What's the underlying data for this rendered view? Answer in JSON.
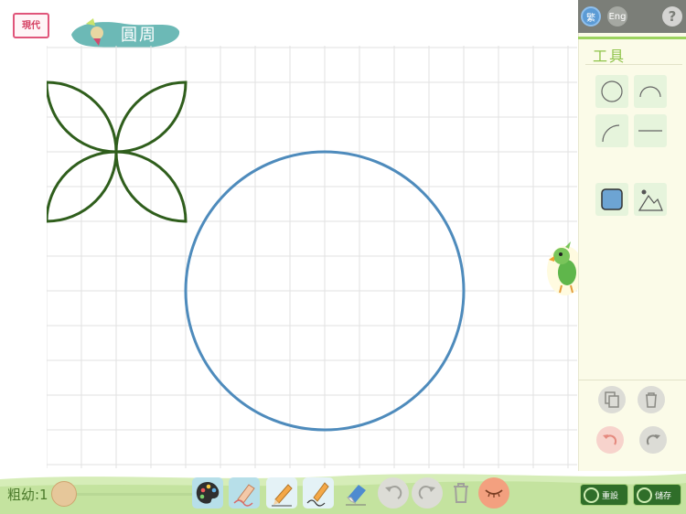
{
  "header": {
    "logo_text": "現代",
    "title": "圓周"
  },
  "lang": {
    "zh": "繁",
    "en": "Eng",
    "help": "?"
  },
  "panel": {
    "tools_label": "工具",
    "tools": [
      "circle-tool",
      "arc-tool",
      "quarter-arc-tool",
      "line-tool",
      "fill-tool",
      "image-tool"
    ]
  },
  "bottom": {
    "thickness_label": "粗幼:1",
    "thickness_value": 1,
    "reset_label": "重設",
    "save_label": "儲存"
  },
  "colors": {
    "shape_green": "#2f5e1c",
    "circle_blue": "#4e8bbc",
    "grid_line": "#e2e2e2",
    "accent_green": "#9dd45f",
    "panel_bg": "#fbfbe8"
  }
}
